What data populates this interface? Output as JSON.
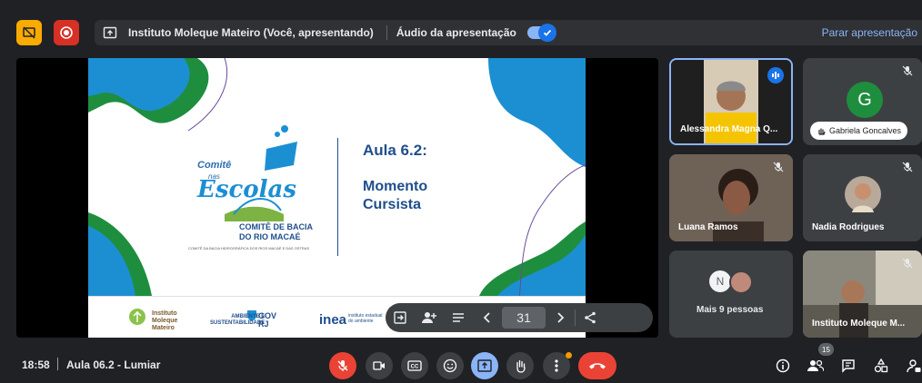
{
  "topbar": {
    "presenter_title": "Instituto Moleque Mateiro (Você, apresentando)",
    "audio_label": "Áudio da apresentação",
    "stop_presenting": "Parar apresentação"
  },
  "slide": {
    "title": "Aula 6.2:",
    "subtitle_line1": "Momento",
    "subtitle_line2": "Cursista",
    "logo_comite": "Comitê",
    "logo_nas": "nas",
    "logo_escolas": "Escolas",
    "logo_bacia_line1": "COMITÊ DE BACIA",
    "logo_bacia_line2": "DO RIO MACAÉ",
    "logo_fine": "COMITÊ DA BACIA HIDROGRÁFICA DOS RIOS MACAÉ E DAS OSTRAS",
    "footer_moleque": "Instituto\nMoleque\nMateiro",
    "footer_ambiente": "AMBIENTE E\nSUSTENTABILIDADE",
    "footer_gov": "GOV\nRJ",
    "footer_inea": "inea",
    "footer_inea_sub": "instituto estadual\ndo ambiente"
  },
  "slide_controls": {
    "page": "31"
  },
  "participants": [
    {
      "name": "Alessandra Magna Q...",
      "speaking": true
    },
    {
      "name": "Gabriela Goncalves",
      "initial": "G",
      "muted": true
    },
    {
      "name": "Luana Ramos",
      "muted": true
    },
    {
      "name": "Nadia Rodrigues",
      "muted": true
    },
    {
      "name": "Mais 9 pessoas",
      "initial": "N"
    },
    {
      "name": "Instituto Moleque M...",
      "muted": true
    }
  ],
  "bottombar": {
    "time": "18:58",
    "meeting_title": "Aula 06.2 - Lumiar",
    "people_count": "15"
  },
  "colors": {
    "accent": "#8ab4f8",
    "danger": "#ea4335",
    "background": "#202124",
    "tile": "#3c4043"
  }
}
